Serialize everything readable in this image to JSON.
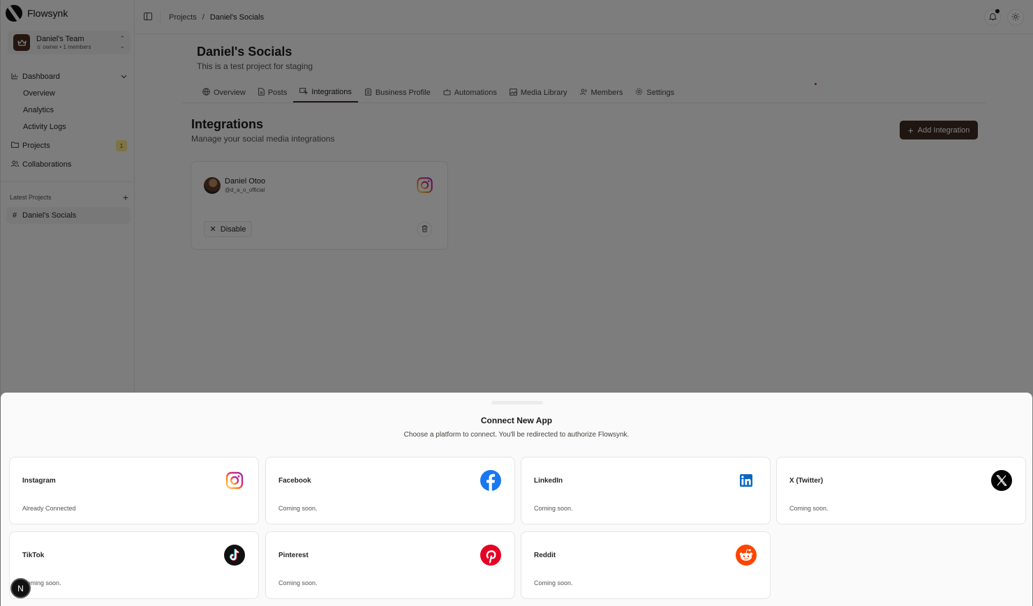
{
  "brand": {
    "name": "Flowsynk"
  },
  "team": {
    "name": "Daniel's Team",
    "role": "owner • 1 members",
    "icon": "crown-icon"
  },
  "sidebar": {
    "dashboard": "Dashboard",
    "sub_items": [
      "Overview",
      "Analytics",
      "Activity Logs"
    ],
    "projects": "Projects",
    "projects_badge": "1",
    "collaborations": "Collaborations",
    "latest_label": "Latest Projects",
    "latest_item": "Daniel's Socials"
  },
  "breadcrumb": {
    "root": "Projects",
    "separator": "/",
    "current": "Daniel's Socials"
  },
  "project": {
    "title": "Daniel's Socials",
    "description": "This is a test project for staging"
  },
  "tabs": [
    {
      "label": "Overview",
      "icon": "globe-icon"
    },
    {
      "label": "Posts",
      "icon": "file-icon"
    },
    {
      "label": "Integrations",
      "icon": "integrations-icon",
      "active": true
    },
    {
      "label": "Business Profile",
      "icon": "building-icon"
    },
    {
      "label": "Automations",
      "icon": "bot-icon"
    },
    {
      "label": "Media Library",
      "icon": "image-icon"
    },
    {
      "label": "Members",
      "icon": "users-icon"
    },
    {
      "label": "Settings",
      "icon": "gear-icon"
    }
  ],
  "integrations": {
    "title": "Integrations",
    "description": "Manage your social media integrations",
    "add_button": "Add Integration",
    "card": {
      "name": "Daniel Otoo",
      "handle": "@d_a_o_official",
      "disable_label": "Disable",
      "platform_icon": "instagram-icon"
    }
  },
  "drawer": {
    "title": "Connect New App",
    "description": "Choose a platform to connect. You'll be redirected to authorize Flowsynk.",
    "apps": [
      {
        "name": "Instagram",
        "status": "Already Connected",
        "icon": "instagram-icon"
      },
      {
        "name": "Facebook",
        "status": "Coming soon.",
        "icon": "facebook-icon"
      },
      {
        "name": "LinkedIn",
        "status": "Coming soon.",
        "icon": "linkedin-icon"
      },
      {
        "name": "X (Twitter)",
        "status": "Coming soon.",
        "icon": "x-icon"
      },
      {
        "name": "TikTok",
        "status": "Coming soon.",
        "icon": "tiktok-icon"
      },
      {
        "name": "Pinterest",
        "status": "Coming soon.",
        "icon": "pinterest-icon"
      },
      {
        "name": "Reddit",
        "status": "Coming soon.",
        "icon": "reddit-icon"
      }
    ]
  },
  "dev_badge": "N",
  "colors": {
    "accent": "#3f2a22",
    "instagram": "#dd2a7b",
    "facebook": "#1877f2",
    "linkedin": "#0a66c2",
    "pinterest": "#e60023",
    "reddit": "#ff4500",
    "badge_bg": "#fde68a"
  }
}
